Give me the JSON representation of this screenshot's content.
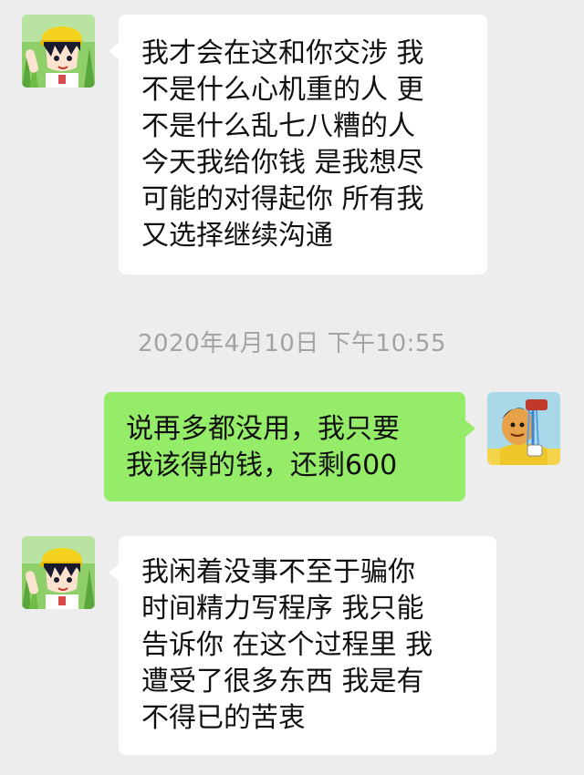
{
  "messages": [
    {
      "direction": "incoming",
      "lines": [
        "我才会在这和你交涉 我",
        "不是什么心机重的人 更",
        "不是什么乱七八糟的人",
        "今天我给你钱 是我想尽",
        "可能的对得起你 所有我",
        "又选择继续沟通"
      ]
    },
    {
      "timestamp": "2020年4月10日 下午10:55"
    },
    {
      "direction": "outgoing",
      "lines": [
        "说再多都没用，我只要",
        "我该得的钱，还剩600"
      ]
    },
    {
      "direction": "incoming",
      "lines": [
        "我闲着没事不至于骗你",
        "时间精力写程序 我只能",
        "告诉你 在这个过程里 我",
        "遭受了很多东西 我是有",
        "不得已的苦衷"
      ]
    }
  ],
  "colors": {
    "background": "#ededed",
    "incoming_bubble": "#ffffff",
    "outgoing_bubble": "#95ec69",
    "timestamp_text": "#a3a3a3"
  }
}
